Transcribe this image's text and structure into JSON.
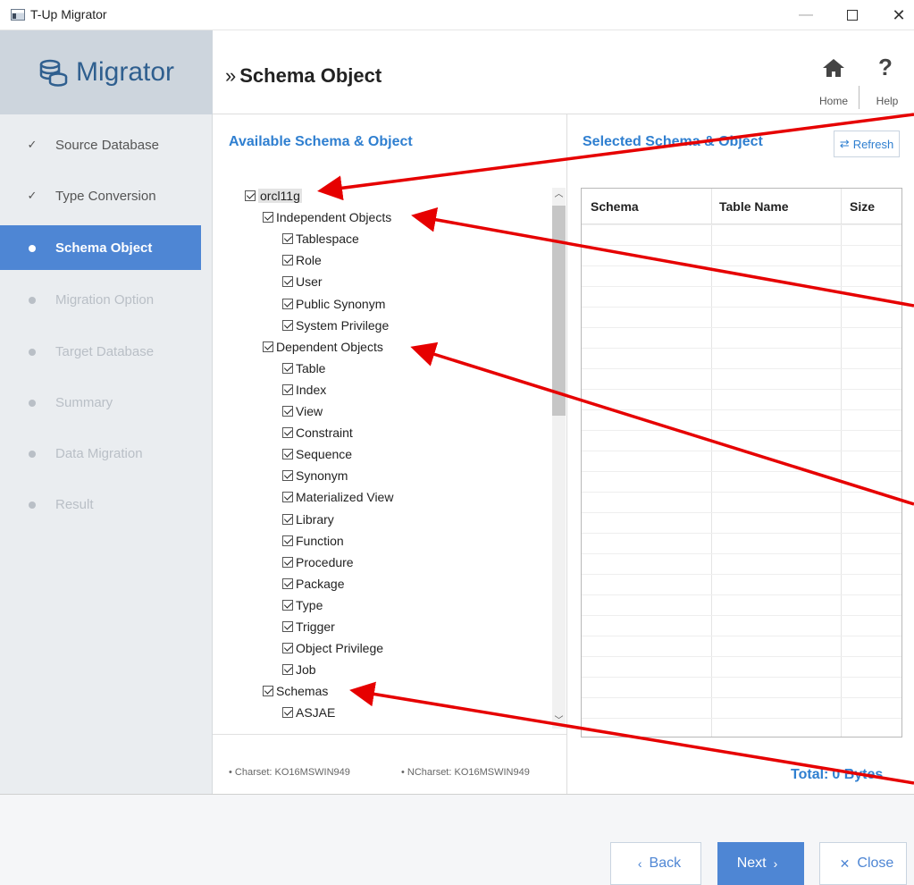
{
  "window": {
    "title": "T-Up Migrator"
  },
  "header": {
    "brand": "Migrator",
    "page_title": "Schema Object",
    "home_label": "Home",
    "help_label": "Help"
  },
  "sidebar": {
    "steps": [
      {
        "label": "Source Database",
        "state": "done"
      },
      {
        "label": "Type Conversion",
        "state": "done"
      },
      {
        "label": "Schema Object",
        "state": "current"
      },
      {
        "label": "Migration Option",
        "state": "pending"
      },
      {
        "label": "Target Database",
        "state": "pending"
      },
      {
        "label": "Summary",
        "state": "pending"
      },
      {
        "label": "Data Migration",
        "state": "pending"
      },
      {
        "label": "Result",
        "state": "pending"
      }
    ]
  },
  "available": {
    "title": "Available Schema & Object",
    "tree": [
      {
        "label": "orcl11g",
        "level": 0,
        "checked": true
      },
      {
        "label": "Independent Objects",
        "level": 1,
        "checked": true
      },
      {
        "label": "Tablespace",
        "level": 2,
        "checked": true
      },
      {
        "label": "Role",
        "level": 2,
        "checked": true
      },
      {
        "label": "User",
        "level": 2,
        "checked": true
      },
      {
        "label": "Public Synonym",
        "level": 2,
        "checked": true
      },
      {
        "label": "System Privilege",
        "level": 2,
        "checked": true
      },
      {
        "label": "Dependent Objects",
        "level": 1,
        "checked": true
      },
      {
        "label": "Table",
        "level": 2,
        "checked": true
      },
      {
        "label": "Index",
        "level": 2,
        "checked": true
      },
      {
        "label": "View",
        "level": 2,
        "checked": true
      },
      {
        "label": "Constraint",
        "level": 2,
        "checked": true
      },
      {
        "label": "Sequence",
        "level": 2,
        "checked": true
      },
      {
        "label": "Synonym",
        "level": 2,
        "checked": true
      },
      {
        "label": "Materialized View",
        "level": 2,
        "checked": true
      },
      {
        "label": "Library",
        "level": 2,
        "checked": true
      },
      {
        "label": "Function",
        "level": 2,
        "checked": true
      },
      {
        "label": "Procedure",
        "level": 2,
        "checked": true
      },
      {
        "label": "Package",
        "level": 2,
        "checked": true
      },
      {
        "label": "Type",
        "level": 2,
        "checked": true
      },
      {
        "label": "Trigger",
        "level": 2,
        "checked": true
      },
      {
        "label": "Object Privilege",
        "level": 2,
        "checked": true
      },
      {
        "label": "Job",
        "level": 2,
        "checked": true
      },
      {
        "label": "Schemas",
        "level": 1,
        "checked": true
      },
      {
        "label": "ASJAE",
        "level": 2,
        "checked": true
      }
    ],
    "charset": "• Charset: KO16MSWIN949",
    "ncharset": "• NCharset: KO16MSWIN949"
  },
  "selected": {
    "title": "Selected Schema & Object",
    "refresh_label": "Refresh",
    "columns": [
      "Schema",
      "Table Name",
      "Size"
    ],
    "total_label": "Total:",
    "total_value": "0 Bytes"
  },
  "footer": {
    "back_label": "Back",
    "next_label": "Next",
    "close_label": "Close"
  },
  "colors": {
    "accent": "#4e86d4",
    "link": "#2f7fd0",
    "annotation": "#e60000"
  }
}
